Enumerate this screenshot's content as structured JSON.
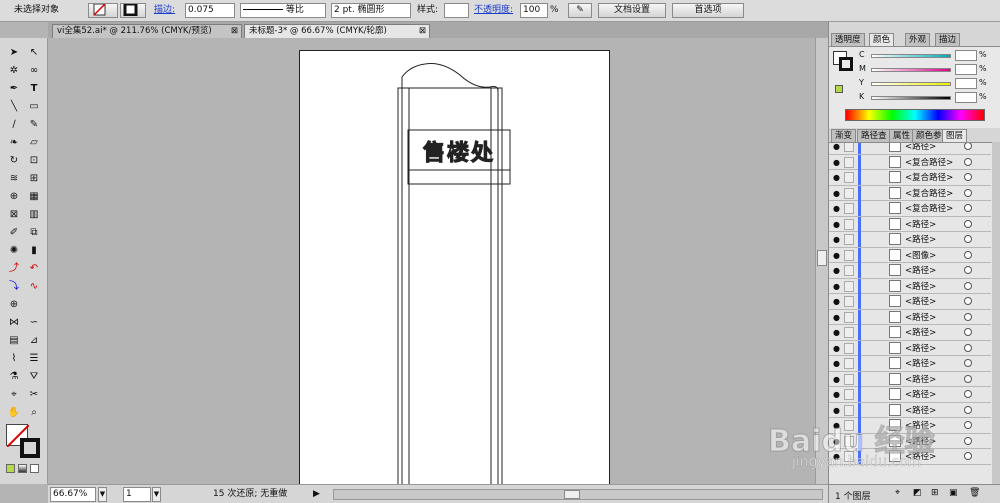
{
  "control_bar": {
    "selection_label": "未选择对象",
    "stroke_link": "描边:",
    "stroke_weight": "0.075",
    "stroke_profile": "等比",
    "brush_label": "2 pt. 椭圆形",
    "style_label": "样式:",
    "opacity_link": "不透明度:",
    "opacity_value": "100",
    "opacity_unit": "%",
    "doc_setup_button": "文档设置",
    "preferences_button": "首选项"
  },
  "doc_tabs": [
    {
      "label": "vi全集52.ai* @ 211.76% (CMYK/预览)",
      "close": "⊠"
    },
    {
      "label": "未标题-3* @ 66.67% (CMYK/轮廓)",
      "close": "⊠"
    }
  ],
  "artwork": {
    "sign_text": "售楼处"
  },
  "status_bar": {
    "zoom": "66.67%",
    "page": "1",
    "undo_status": "15 次还原; 无重做"
  },
  "color_panel": {
    "tabs": [
      "透明度",
      "颜色",
      "外观",
      "描边"
    ],
    "channels": [
      "C",
      "M",
      "Y",
      "K"
    ],
    "values": [
      "",
      "",
      "",
      ""
    ],
    "unit": "%",
    "accent_swatch": "#b6d94a"
  },
  "layers_panel": {
    "tabs": [
      "渐变",
      "路径查",
      "属性",
      "颜色参",
      "图层"
    ],
    "rows": [
      {
        "name": "<路径>"
      },
      {
        "name": "<复合路径>"
      },
      {
        "name": "<复合路径>"
      },
      {
        "name": "<复合路径>"
      },
      {
        "name": "<复合路径>"
      },
      {
        "name": "<路径>"
      },
      {
        "name": "<路径>"
      },
      {
        "name": "<图像>"
      },
      {
        "name": "<路径>"
      },
      {
        "name": "<路径>"
      },
      {
        "name": "<路径>"
      },
      {
        "name": "<路径>"
      },
      {
        "name": "<路径>"
      },
      {
        "name": "<路径>"
      },
      {
        "name": "<路径>"
      },
      {
        "name": "<路径>"
      },
      {
        "name": "<路径>"
      },
      {
        "name": "<路径>"
      },
      {
        "name": "<路径>"
      },
      {
        "name": "<路径>"
      },
      {
        "name": "<路径>"
      }
    ],
    "footer": "1 个图层"
  },
  "watermark": {
    "brand": "Baidu 经验",
    "url": "jingyan.baidu.com"
  }
}
